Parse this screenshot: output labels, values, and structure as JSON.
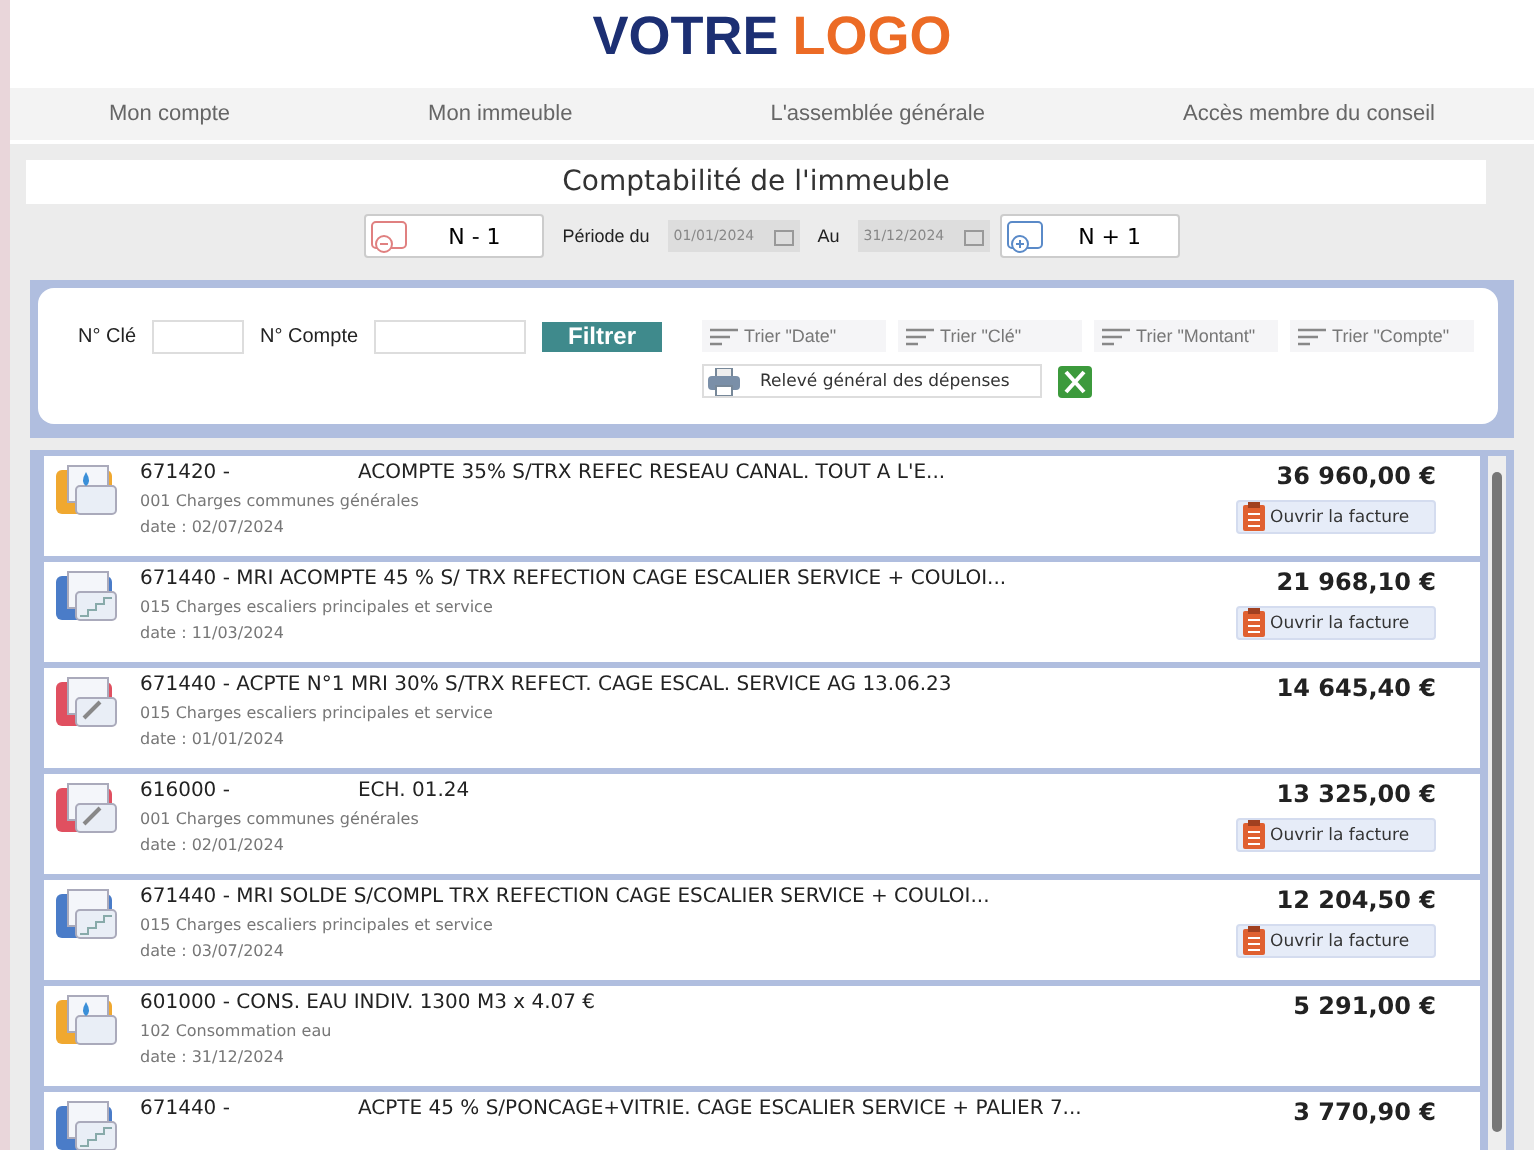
{
  "logo": {
    "part_1": "VOTRE",
    "part_2": "LOGO"
  },
  "nav": [
    "Mon compte",
    "Mon immeuble",
    "L'assemblée générale",
    "Accès membre du conseil"
  ],
  "page_title": "Comptabilité de l'immeuble",
  "period": {
    "prev": "N - 1",
    "from_label": "Période du",
    "from": "01/01/2024",
    "to_label": "Au",
    "to": "31/12/2024",
    "next": "N + 1"
  },
  "filters": {
    "key_label": "N° Clé",
    "account_label": "N° Compte",
    "filter_button": "Filtrer",
    "sorts": [
      "Trier \"Date\"",
      "Trier \"Clé\"",
      "Trier \"Montant\"",
      "Trier \"Compte\""
    ],
    "report_button": "Relevé général des dépenses"
  },
  "entries": [
    {
      "title_start": "671420 -",
      "title_end": "ACOMPTE 35% S/TRX REFEC RESEAU CANAL. TOUT A L'E...",
      "key": "001 Charges communes générales",
      "date": "date : 02/07/2024",
      "amount": "36 960,00 €",
      "kind": "water",
      "invoice": "Ouvrir la facture"
    },
    {
      "title_start": "671440 - MRI ACOMPTE 45 % S/ TRX REFECTION CAGE ESCALIER SERVICE + COULOI...",
      "key": "015 Charges escaliers principales et service",
      "date": "date : 11/03/2024",
      "amount": "21 968,10 €",
      "kind": "stairs",
      "invoice": "Ouvrir la facture"
    },
    {
      "title_start": "671440 - ACPTE N°1 MRI 30% S/TRX REFECT. CAGE ESCAL. SERVICE AG 13.06.23",
      "key": "015 Charges escaliers principales et service",
      "date": "date : 01/01/2024",
      "amount": "14 645,40 €",
      "kind": "tools"
    },
    {
      "title_start": "616000 -",
      "title_end": "ECH. 01.24",
      "key": "001 Charges communes générales",
      "date": "date : 02/01/2024",
      "amount": "13 325,00 €",
      "kind": "tools",
      "invoice": "Ouvrir la facture"
    },
    {
      "title_start": "671440 - MRI SOLDE S/COMPL TRX REFECTION CAGE ESCALIER SERVICE + COULOI...",
      "key": "015 Charges escaliers principales et service",
      "date": "date : 03/07/2024",
      "amount": "12 204,50 €",
      "kind": "stairs",
      "invoice": "Ouvrir la facture"
    },
    {
      "title_start": "601000 - CONS. EAU INDIV. 1300 M3 x 4.07 €",
      "key": "102 Consommation eau",
      "date": "date : 31/12/2024",
      "amount": "5 291,00 €",
      "kind": "water"
    },
    {
      "title_start": "671440 -",
      "title_end": "ACPTE 45 % S/PONCAGE+VITRIE. CAGE ESCALIER SERVICE + PALIER 7...",
      "amount": "3 770,90 €",
      "kind": "stairs"
    }
  ]
}
